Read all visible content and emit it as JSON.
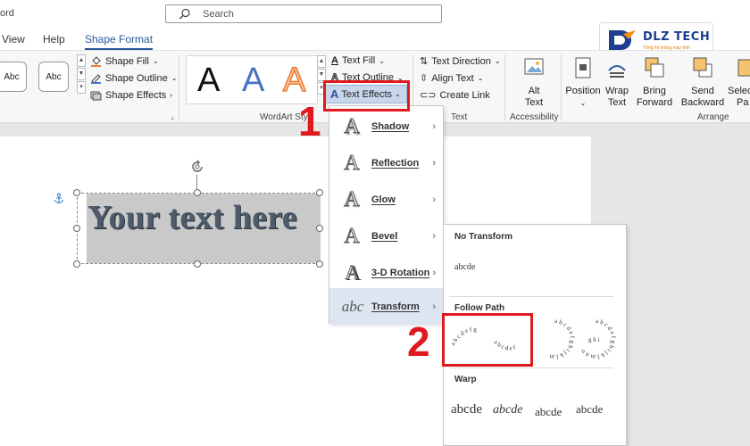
{
  "titlebar": {
    "app_title": "ord",
    "search_placeholder": "Search"
  },
  "tabs": [
    {
      "label": "View"
    },
    {
      "label": "Help"
    },
    {
      "label": "Shape Format"
    }
  ],
  "logo": {
    "text": "DLZ TECH",
    "tagline": "Tổng hệ thống máy tính"
  },
  "ribbon": {
    "shape_styles": {
      "swatch_1": "Abc",
      "swatch_2": "Abc",
      "shape_fill": "Shape Fill",
      "shape_outline": "Shape Outline",
      "shape_effects": "Shape Effects"
    },
    "wordart": {
      "letters": [
        "A",
        "A",
        "A"
      ],
      "text_fill": "Text Fill",
      "text_outline": "Text Outline",
      "text_effects": "Text Effects",
      "group_label": "WordArt Styl"
    },
    "text": {
      "text_direction": "Text Direction",
      "align_text": "Align Text",
      "create_link": "Create Link",
      "group_label": "Text"
    },
    "accessibility": {
      "alt_text_1": "Alt",
      "alt_text_2": "Text",
      "group_label": "Accessibility"
    },
    "arrange": {
      "position": "Position",
      "wrap_1": "Wrap",
      "wrap_2": "Text",
      "bring_1": "Bring",
      "bring_2": "Forward",
      "send_1": "Send",
      "send_2": "Backward",
      "select_1": "Selec",
      "select_2": "Pa",
      "group_label": "Arrange"
    }
  },
  "document": {
    "wordart_text": "Your text here"
  },
  "effects_menu": {
    "items": [
      {
        "label": "Shadow"
      },
      {
        "label": "Reflection"
      },
      {
        "label": "Glow"
      },
      {
        "label": "Bevel"
      },
      {
        "label": "3-D Rotation"
      },
      {
        "label": "Transform"
      }
    ]
  },
  "transform_menu": {
    "no_transform_heading": "No Transform",
    "no_transform_sample": "abcde",
    "follow_path_heading": "Follow Path",
    "warp_heading": "Warp",
    "warp_samples": [
      "abcde",
      "abcde",
      "abcde",
      "abcde"
    ]
  },
  "annotations": {
    "step_1": "1",
    "step_2": "2"
  },
  "colors": {
    "accent": "#2b579a",
    "highlight": "#e0191f",
    "selected_button": "#c7d6ea"
  }
}
